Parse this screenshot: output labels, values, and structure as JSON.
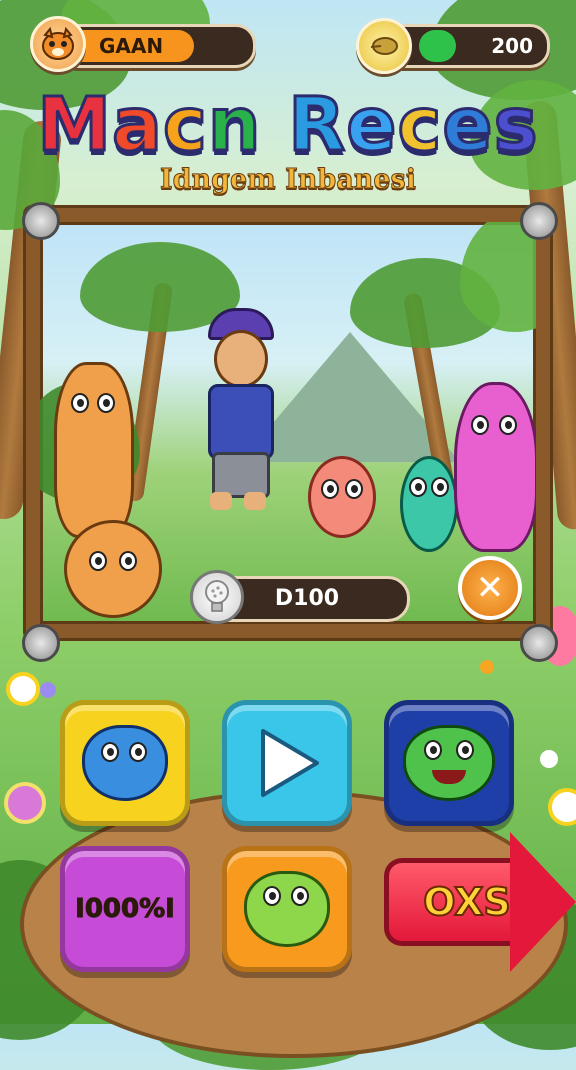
{
  "hud": {
    "player_name": "GAAN",
    "player_avatar_icon": "tiger-face-icon",
    "player_bar_level": 0.7,
    "player_bar_color": "#f7941d",
    "coins": "200",
    "coin_icon": "coin-icon",
    "coin_bar_level": 0.3,
    "coin_bar_color": "#2fc24a"
  },
  "title": {
    "main": "Macn Reces",
    "subtitle": "Idngem Inbanesi",
    "letter_colors": [
      "#e8323f",
      "#f04a2a",
      "#f7a21b",
      "#2ab24a",
      "#2a9be0",
      "#3aa0f0",
      "#f2c12e",
      "#2f7bd8",
      "#4b4fd0",
      "#6a45c8"
    ]
  },
  "scene": {
    "score_value": "D100",
    "hint_icon": "lightbulb-icon",
    "close_icon": "close-icon",
    "close_symbol": "✕"
  },
  "buttons": {
    "btn1_icon": "blue-fish-icon",
    "play_icon": "play-icon",
    "btn3_icon": "green-frog-icon",
    "btn4_label": "I000%I",
    "btn5_icon": "green-lizard-icon",
    "next_label": "OXS",
    "next_icon": "arrow-right-icon"
  },
  "colors": {
    "btn_yellow": "#f7d21e",
    "btn_cyan": "#39c6e8",
    "btn_navy": "#1f3fa8",
    "btn_purple": "#c64bd6",
    "btn_orange": "#f79a1e",
    "btn_red": "#e3183a"
  }
}
